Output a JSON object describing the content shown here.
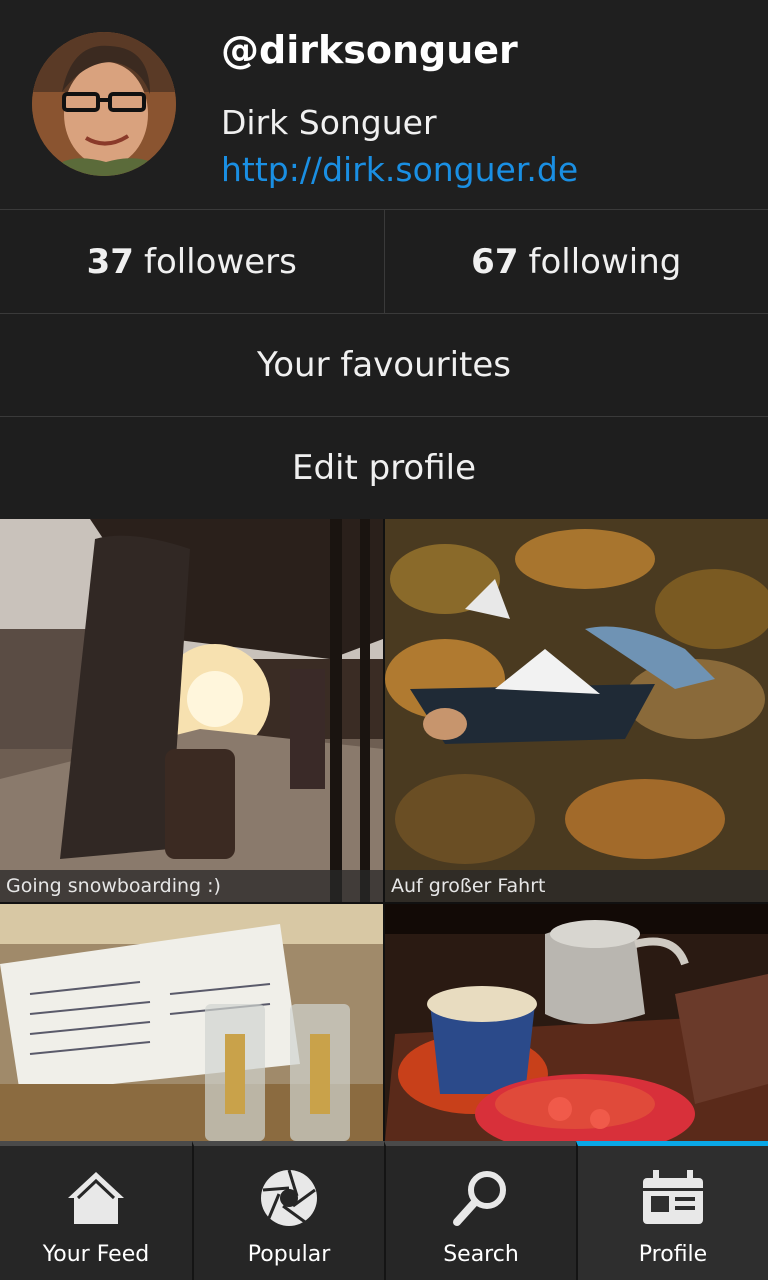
{
  "profile": {
    "username": "@dirksonguer",
    "full_name": "Dirk Songuer",
    "website": "http://dirk.songuer.de"
  },
  "stats": {
    "followers_count": "37",
    "followers_label": "followers",
    "following_count": "67",
    "following_label": "following"
  },
  "actions": {
    "favourites_label": "Your favourites",
    "edit_profile_label": "Edit profile"
  },
  "photos": [
    {
      "caption": "Going snowboarding :)"
    },
    {
      "caption": "Auf großer Fahrt"
    },
    {
      "caption": ""
    },
    {
      "caption": ""
    }
  ],
  "tabs": [
    {
      "label": "Your Feed",
      "icon": "home-icon"
    },
    {
      "label": "Popular",
      "icon": "aperture-icon"
    },
    {
      "label": "Search",
      "icon": "search-icon"
    },
    {
      "label": "Profile",
      "icon": "profile-calendar-icon",
      "active": true
    }
  ],
  "colors": {
    "accent": "#0aa7e6",
    "link": "#1a8fe3",
    "background": "#1e1e1e"
  }
}
